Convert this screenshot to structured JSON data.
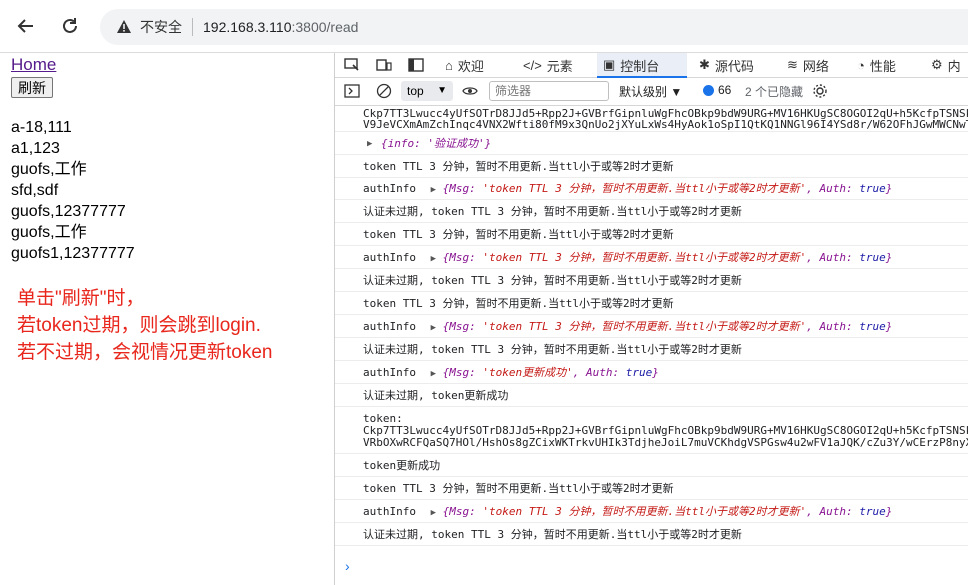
{
  "browser": {
    "back_icon": "back-arrow-icon",
    "reload_icon": "reload-icon",
    "security_text": "不安全",
    "url_host": "192.168.3.110",
    "url_rest": ":3800/read"
  },
  "page": {
    "home_link": "Home",
    "refresh_button": "刷新",
    "items": [
      "a-18,111",
      "a1,123",
      "guofs,工作",
      "sfd,sdf",
      "guofs,12377777",
      "guofs,工作",
      "guofs1,12377777"
    ],
    "note_lines": [
      "单击\"刷新\"时，",
      "若token过期，则会跳到login.",
      "若不过期，会视情况更新token"
    ]
  },
  "devtools": {
    "tabs": [
      {
        "label": "欢迎",
        "icon": "home-icon"
      },
      {
        "label": "元素",
        "icon": "code-icon"
      },
      {
        "label": "控制台",
        "icon": "console-icon"
      },
      {
        "label": "源代码",
        "icon": "bug-icon"
      },
      {
        "label": "网络",
        "icon": "wifi-icon"
      },
      {
        "label": "性能",
        "icon": "gauge-icon"
      },
      {
        "label": "内",
        "icon": "gear-icon"
      }
    ],
    "context": "top",
    "filter_placeholder": "筛选器",
    "level": "默认级别",
    "message_count": "66",
    "hidden_text": "2 个已隐藏",
    "accent": "#1a73e8",
    "console": {
      "top_line1": "Ckp7TT3Lwucc4yUfSOTrD8JJd5+Rpp2J+GVBrfGipnluWgFhcOBkp9bdW9URG+MV16HKUgSC8OGOI2qU+h5KcfpTSNSk/tO8DkbsF",
      "top_line2": "V9JeVCXmAmZchInqc4VNX2Wfti80fM9x3QnUo2jXYuLxWs4HyAok1oSpI1QtKQ1NNGl96I4YSd8r/W62OFhJGwMWCNwTdcLZhEGfU",
      "info_obj": "{info: '验证成功'}",
      "ttl_line": "token TTL 3 分钟，暂时不用更新.当ttl小于或等2时才更新",
      "authinfo_label": "authInfo",
      "authinfo_obj_prefix": "{Msg: ",
      "authinfo_msg": "'token TTL 3 分钟，暂时不用更新.当ttl小于或等2时才更新'",
      "auth_part": ", Auth: ",
      "auth_true": "true",
      "obj_close": "}",
      "verified_line": "认证未过期, token TTL 3 分钟，暂时不用更新.当ttl小于或等2时才更新",
      "update_obj_msg": "'token更新成功'",
      "verified_update_line": "认证未过期, token更新成功",
      "token_label": "token:",
      "token_line1": "Ckp7TT3Lwucc4yUfSOTrD8JJd5+Rpp2J+GVBrfGipnluWgFhcOBkp9bdW9URG+MV16HKUgSC8OGOI2qU+h5KcfpTSNSk/tO8Dkbsf",
      "token_line2": "VRbOXwRCFQaSQ7HOl/HshOs8gZCixWKTrkvUHIk3TdjheJoiL7muVCKhdgVSPGsw4u2wFV1aJQK/cZu3Y/wCErzP8nyXW61/AMsGu",
      "update_line": "token更新成功"
    }
  }
}
